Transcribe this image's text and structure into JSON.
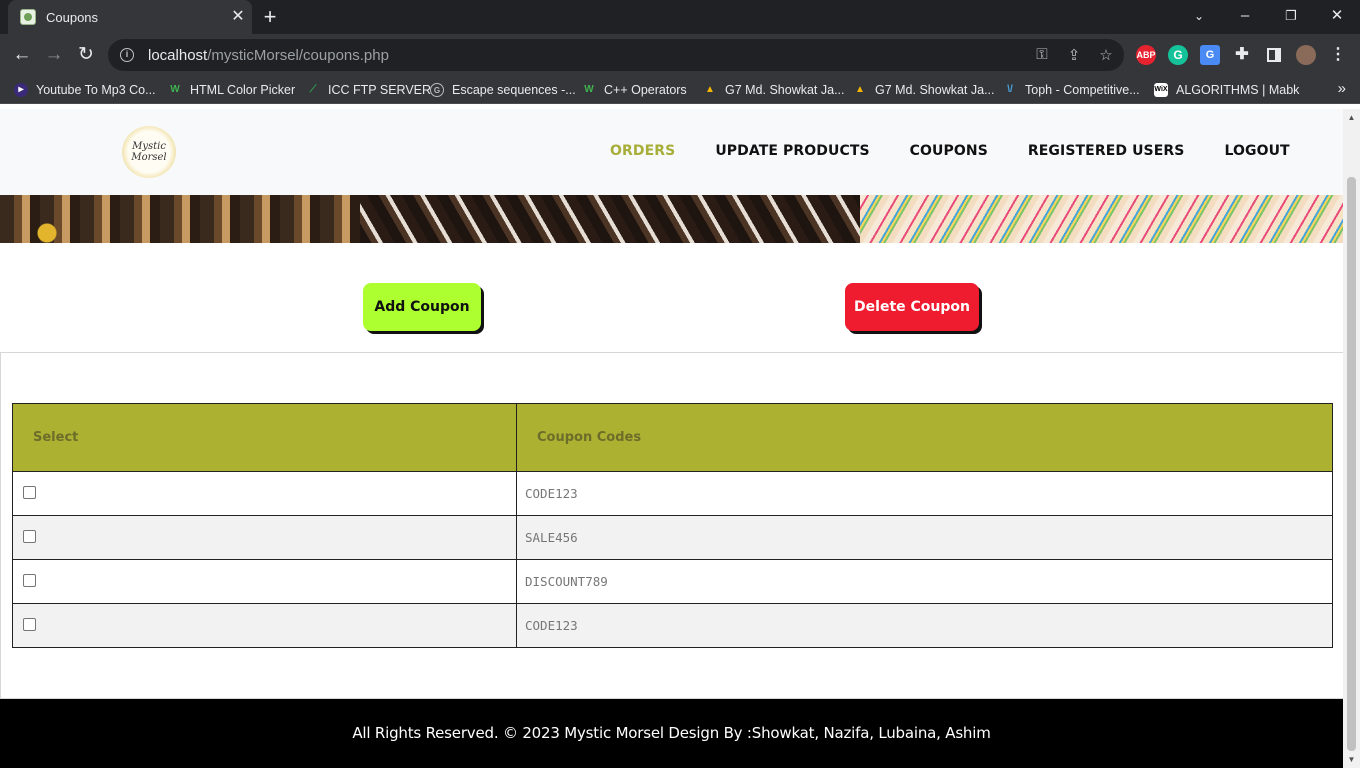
{
  "browser": {
    "tab_title": "Coupons",
    "url_host": "localhost",
    "url_path": "/mysticMorsel/coupons.php",
    "bookmarks": [
      {
        "label": "Youtube To Mp3 Co...",
        "icon": "play-icon",
        "color": "#7b3fe4"
      },
      {
        "label": "HTML Color Picker",
        "icon": "w-icon",
        "color": "#4caf50"
      },
      {
        "label": "ICC FTP SERVER",
        "icon": "leaf-icon",
        "color": "#2e9e4f"
      },
      {
        "label": "Escape sequences -...",
        "icon": "c-icon",
        "color": "#aaaaaa"
      },
      {
        "label": "C++ Operators",
        "icon": "w-icon",
        "color": "#4caf50"
      },
      {
        "label": "G7 Md. Showkat Ja...",
        "icon": "drive-icon",
        "color": "#f4b400"
      },
      {
        "label": "G7 Md. Showkat Ja...",
        "icon": "drive-icon",
        "color": "#f4b400"
      },
      {
        "label": "Toph - Competitive...",
        "icon": "toph-icon",
        "color": "#4aa3df"
      },
      {
        "label": "ALGORITHMS | Mabk",
        "icon": "wix-icon",
        "color": "#ffffff"
      }
    ]
  },
  "site": {
    "logo_line1": "Mystic",
    "logo_line2": "Morsel",
    "nav": [
      "ORDERS",
      "UPDATE PRODUCTS",
      "COUPONS",
      "REGISTERED USERS",
      "LOGOUT"
    ],
    "active_nav": "ORDERS"
  },
  "actions": {
    "add_label": "Add Coupon",
    "delete_label": "Delete Coupon"
  },
  "table": {
    "headers": [
      "Select",
      "Coupon Codes"
    ],
    "rows": [
      "CODE123",
      "SALE456",
      "DISCOUNT789",
      "CODE123"
    ]
  },
  "footer": {
    "text": "All Rights Reserved. © 2023 Mystic Morsel Design By :Showkat, Nazifa, Lubaina, Ashim"
  }
}
